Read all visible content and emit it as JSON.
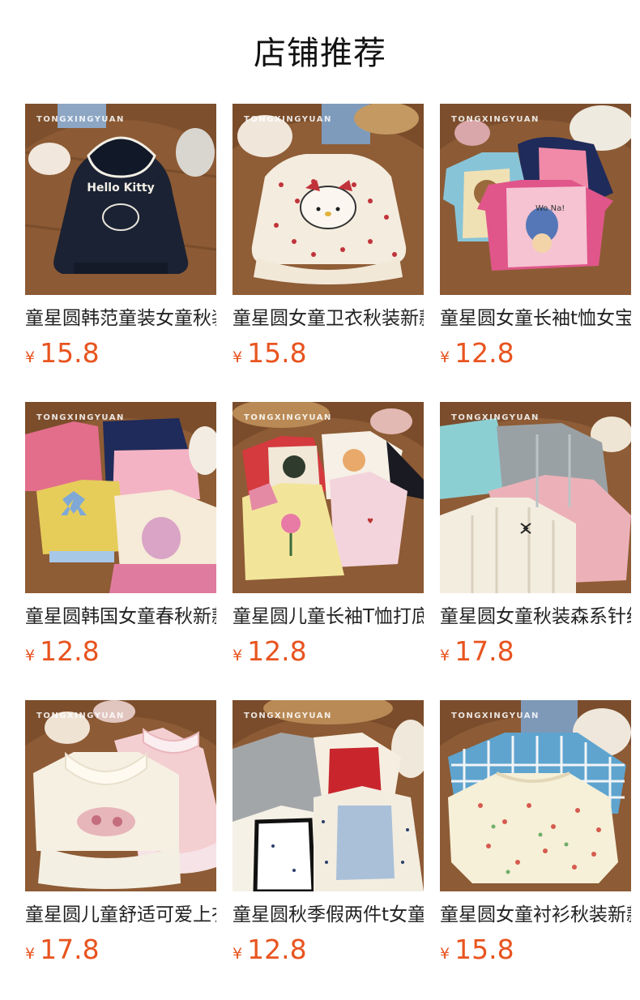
{
  "header": {
    "title": "店铺推荐"
  },
  "colors": {
    "price": "#e8541f",
    "title": "#111111",
    "name": "#222222"
  },
  "products": [
    {
      "name": "童星圆韩范童装女童秋装",
      "currency": "¥",
      "price": "15.8",
      "watermark": "TONGXINGYUAN",
      "image": "navy-hello-kitty-hoodie"
    },
    {
      "name": "童星圆女童卫衣秋装新款",
      "currency": "¥",
      "price": "15.8",
      "watermark": "TONGXINGYUAN",
      "image": "cream-cherry-kitty-sweatshirt"
    },
    {
      "name": "童星圆女童长袖t恤女宝",
      "currency": "¥",
      "price": "12.8",
      "watermark": "TONGXINGYUAN",
      "image": "raglan-print-tees"
    },
    {
      "name": "童星圆韩国女童春秋新款",
      "currency": "¥",
      "price": "12.8",
      "watermark": "TONGXINGYUAN",
      "image": "fake-two-piece-tops"
    },
    {
      "name": "童星圆儿童长袖T恤打底",
      "currency": "¥",
      "price": "12.8",
      "watermark": "TONGXINGYUAN",
      "image": "raglan-cartoon-tees"
    },
    {
      "name": "童星圆女童秋装森系针织",
      "currency": "¥",
      "price": "17.8",
      "watermark": "TONGXINGYUAN",
      "image": "cable-knit-cardigans"
    },
    {
      "name": "童星圆儿童舒适可爱上衣",
      "currency": "¥",
      "price": "17.8",
      "watermark": "TONGXINGYUAN",
      "image": "ruffle-collar-sweatshirts"
    },
    {
      "name": "童星圆秋季假两件t女童",
      "currency": "¥",
      "price": "12.8",
      "watermark": "TONGXINGYUAN",
      "image": "camisole-layer-tees"
    },
    {
      "name": "童星圆女童衬衫秋装新款",
      "currency": "¥",
      "price": "15.8",
      "watermark": "TONGXINGYUAN",
      "image": "floral-gingham-blouses"
    }
  ]
}
